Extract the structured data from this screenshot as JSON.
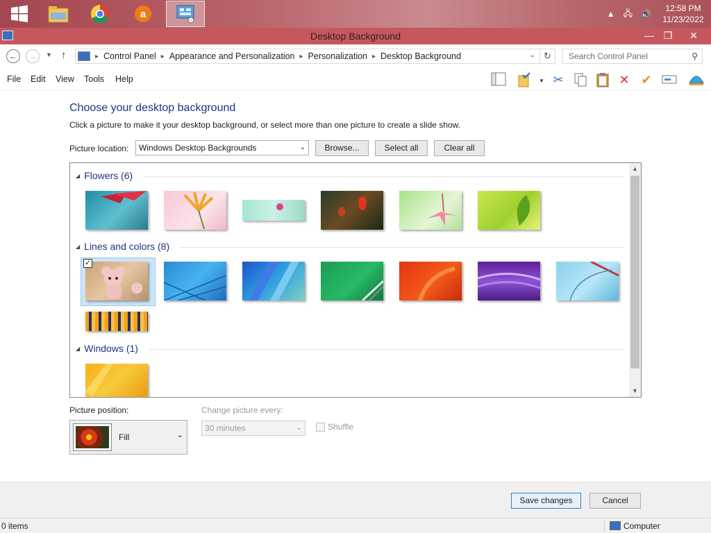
{
  "taskbar": {
    "apps": [
      {
        "name": "file-explorer",
        "icon": "folder-icon"
      },
      {
        "name": "chrome",
        "icon": "chrome-icon"
      },
      {
        "name": "avast",
        "icon": "avast-icon"
      },
      {
        "name": "control-panel",
        "icon": "control-panel-icon",
        "active": true
      }
    ],
    "clock_time": "12:58 PM",
    "clock_date": "11/23/2022"
  },
  "window": {
    "title": "Desktop Background"
  },
  "address": {
    "crumbs": [
      "Control Panel",
      "Appearance and Personalization",
      "Personalization",
      "Desktop Background"
    ],
    "search_placeholder": "Search Control Panel"
  },
  "menu": {
    "items": [
      "File",
      "Edit",
      "View",
      "Tools",
      "Help"
    ]
  },
  "main": {
    "heading": "Choose your desktop background",
    "subtext": "Click a picture to make it your desktop background, or select more than one picture to create a slide show.",
    "location_label": "Picture location:",
    "location_value": "Windows Desktop Backgrounds",
    "browse_label": "Browse...",
    "select_all_label": "Select all",
    "clear_all_label": "Clear all",
    "groups": [
      {
        "label": "Flowers (6)"
      },
      {
        "label": "Lines and colors (8)"
      },
      {
        "label": "Windows (1)"
      }
    ],
    "position_label": "Picture position:",
    "position_value": "Fill",
    "change_label": "Change picture every:",
    "change_value": "30 minutes",
    "shuffle_label": "Shuffle"
  },
  "footer": {
    "save_label": "Save changes",
    "cancel_label": "Cancel"
  },
  "status": {
    "items": "0 items",
    "computer": "Computer"
  },
  "colors": {
    "heading_blue": "#1e3287",
    "titlebar": "#c5585e"
  }
}
